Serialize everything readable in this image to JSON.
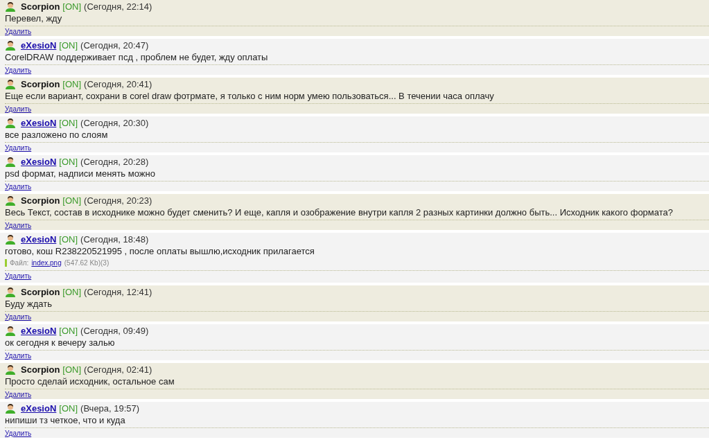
{
  "messages": [
    {
      "kind": "plain",
      "author": "Scorpion",
      "status": "[ON]",
      "time": "(Сегодня, 22:14)",
      "text": "Перевел, жду",
      "delete": "Удалить"
    },
    {
      "kind": "link",
      "author": "eXesioN",
      "status": "[ON]",
      "time": "(Сегодня, 20:47)",
      "text": "CorelDRAW поддерживает псд , проблем не будет, жду оплаты",
      "delete": "Удалить"
    },
    {
      "kind": "plain",
      "author": "Scorpion",
      "status": "[ON]",
      "time": "(Сегодня, 20:41)",
      "text": "Еще если вариант, сохрани в corel draw фотрмате, я только с ним норм умею пользоваться... В течении часа оплачу",
      "delete": "Удалить"
    },
    {
      "kind": "link",
      "author": "eXesioN",
      "status": "[ON]",
      "time": "(Сегодня, 20:30)",
      "text": "все разложено по слоям",
      "delete": "Удалить"
    },
    {
      "kind": "link",
      "author": "eXesioN",
      "status": "[ON]",
      "time": "(Сегодня, 20:28)",
      "text": "psd формат, надписи менять можно",
      "delete": "Удалить"
    },
    {
      "kind": "plain",
      "author": "Scorpion",
      "status": "[ON]",
      "time": "(Сегодня, 20:23)",
      "text": "Весь Текст, состав в исходнике можно будет сменить? И еще, капля и озображение внутри капля 2 разных картинки должно быть... Исходник какого формата?",
      "delete": "Удалить"
    },
    {
      "kind": "link",
      "author": "eXesioN",
      "status": "[ON]",
      "time": "(Сегодня, 18:48)",
      "text": "готово, кош R238220521995 , после оплаты вышлю,исходник прилагается",
      "file": {
        "label": "Файл:",
        "name": "index.png",
        "info": "(547.62 Kb)(3)"
      },
      "delete": "Удалить"
    },
    {
      "kind": "plain",
      "author": "Scorpion",
      "status": "[ON]",
      "time": "(Сегодня, 12:41)",
      "text": "Буду ждать",
      "delete": "Удалить"
    },
    {
      "kind": "link",
      "author": "eXesioN",
      "status": "[ON]",
      "time": "(Сегодня, 09:49)",
      "text": "ок сегодня к вечеру залью",
      "delete": "Удалить"
    },
    {
      "kind": "plain",
      "author": "Scorpion",
      "status": "[ON]",
      "time": "(Сегодня, 02:41)",
      "text": "Просто сделай исходник, остальное сам",
      "delete": "Удалить"
    },
    {
      "kind": "link",
      "author": "eXesioN",
      "status": "[ON]",
      "time": "(Вчера, 19:57)",
      "text": "нипиши тз четкое, что и куда",
      "delete": "Удалить"
    }
  ]
}
